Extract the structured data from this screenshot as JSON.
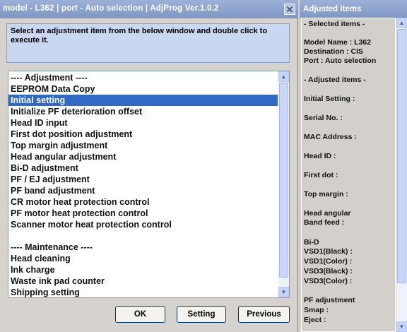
{
  "window": {
    "title": "model - L362  |  port - Auto selection  |  AdjProg Ver.1.0.2",
    "instruction": "Select an adjustment item from the below window and double click to execute it."
  },
  "list": {
    "items": [
      "---- Adjustment ----",
      "EEPROM Data Copy",
      "Initial setting",
      "Initialize PF deterioration offset",
      "Head ID input",
      "First dot position adjustment",
      "Top margin adjustment",
      "Head angular adjustment",
      "Bi-D adjustment",
      "PF / EJ adjustment",
      "PF band adjustment",
      "CR motor heat protection control",
      "PF motor heat protection control",
      "Scanner motor heat protection control",
      "",
      "---- Maintenance ----",
      "Head cleaning",
      "Ink charge",
      "Waste ink pad counter",
      "Shipping setting"
    ],
    "selected_index": 2
  },
  "buttons": {
    "ok": "OK",
    "setting": "Setting",
    "previous": "Previous"
  },
  "panel": {
    "title": "Adjusted items",
    "selected_header": "- Selected items -",
    "model": "Model Name : L362",
    "destination": "Destination : CIS",
    "port": "Port : Auto selection",
    "adjusted_header": "- Adjusted items -",
    "initial_setting": "Initial Setting :",
    "serial_no": "Serial No. :",
    "mac_address": "MAC Address :",
    "head_id": "Head ID :",
    "first_dot": "First dot :",
    "top_margin": "Top margin :",
    "head_angular": "Head angular",
    "band_feed": " Band feed :",
    "bi_d": "Bi-D",
    "vsd1_black": " VSD1(Black) :",
    "vsd1_color": " VSD1(Color) :",
    "vsd3_black": " VSD3(Black) :",
    "vsd3_color": " VSD3(Color) :",
    "pf_adjustment": "PF adjustment",
    "smap": "Smap :",
    "eject": "Eject :"
  },
  "icons": {
    "close": "close-icon",
    "scroll_up": "arrow-up-icon",
    "scroll_down": "arrow-down-icon"
  },
  "colors": {
    "titlebar": "#8fa3cf",
    "selection": "#316ac5",
    "instruction_bg": "#c9d7f1"
  }
}
